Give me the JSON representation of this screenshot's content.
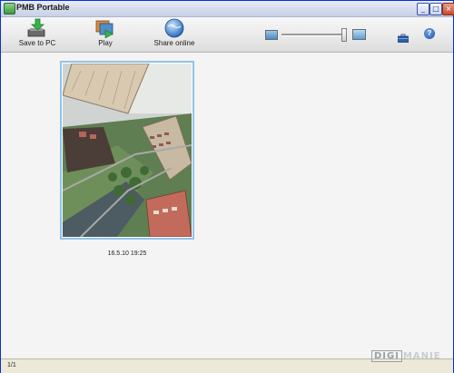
{
  "window": {
    "title": "PMB Portable",
    "controls": {
      "minimize": "_",
      "maximize": "□",
      "close": "×"
    }
  },
  "toolbar": {
    "buttons": [
      {
        "label": "Save to PC",
        "icon": "save-to-pc-icon"
      },
      {
        "label": "Play",
        "icon": "play-slideshow-icon"
      },
      {
        "label": "Share online",
        "icon": "share-online-globe-icon"
      }
    ],
    "zoom": {
      "value": 0.95
    },
    "help_glyph": "?"
  },
  "media": [
    {
      "caption": "16.5.10 19:25"
    }
  ],
  "status": {
    "count": "1/1"
  },
  "watermark": {
    "part1": "DIGI",
    "part2": "MANIE"
  }
}
